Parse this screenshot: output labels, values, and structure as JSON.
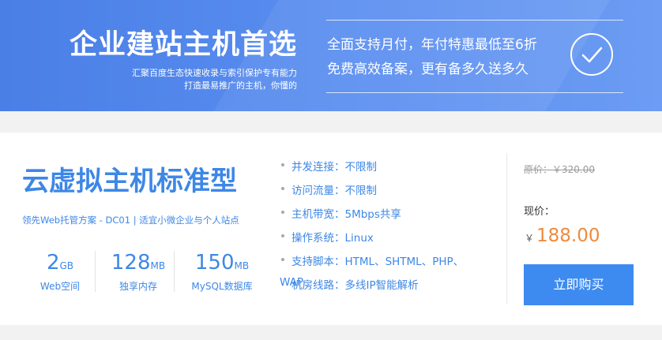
{
  "banner": {
    "title": "企业建站主机首选",
    "subtitle_line1": "汇聚百度生态快速收录与索引保护专有能力",
    "subtitle_line2": "打造最易推广的主机，你懂的",
    "feature_line1": "全面支持月付，年付特惠最低至6折",
    "feature_line2": "免费高效备案，更有备多久送多久",
    "icon": "check-circle-icon"
  },
  "product": {
    "title": "云虚拟主机标准型",
    "description": "领先Web托管方案 - DC01 | 适宜小微企业与个人站点",
    "specs": [
      {
        "value": "2",
        "unit": "GB",
        "label": "Web空间"
      },
      {
        "value": "128",
        "unit": "MB",
        "label": "独享内存"
      },
      {
        "value": "150",
        "unit": "MB",
        "label": "MySQL数据库"
      }
    ],
    "features": [
      "并发连接：不限制",
      "访问流量：不限制",
      "主机带宽：5Mbps共享",
      "操作系统：Linux",
      "支持脚本：HTML、SHTML、PHP、"
    ],
    "feature_overlap_prefix": "WAP",
    "feature_overlap_text": "机房线路：多线IP智能解析"
  },
  "pricing": {
    "original_price": "原价：￥320.00",
    "now_label": "现价：",
    "currency": "￥",
    "now_price": "188.00",
    "buy_label": "立即购买"
  },
  "colors": {
    "accent": "#3d87e6",
    "banner": "#4a7fe6",
    "price": "#f08a3c",
    "button": "#3d8bf0"
  }
}
